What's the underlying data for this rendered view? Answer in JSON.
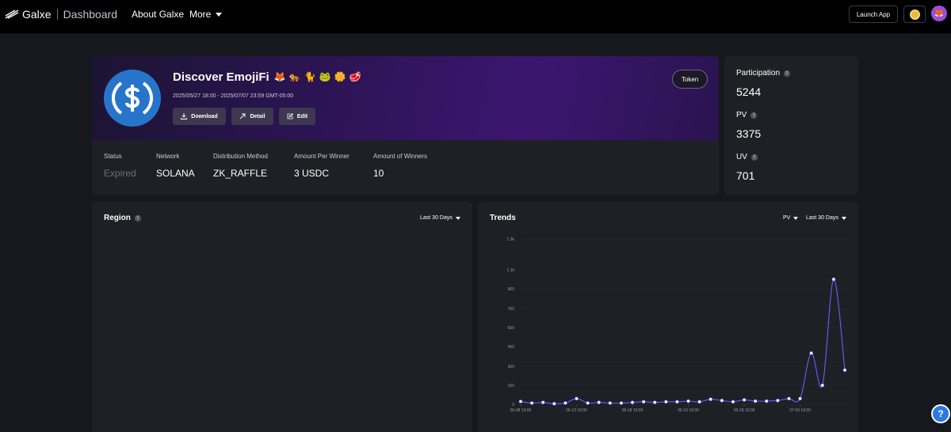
{
  "topbar": {
    "brand": "Galxe",
    "section": "Dashboard",
    "nav": {
      "about": "About Galxe",
      "more": "More"
    },
    "launch_label": "Launch App"
  },
  "campaign": {
    "title": "Discover EmojiFi",
    "emojis": [
      "🦊",
      "🐅",
      "🐈",
      "🐸",
      "🌼",
      "🥩"
    ],
    "dates": "2025/05/27 18:00 - 2025/07/07 23:59 GMT-05:00",
    "buttons": {
      "download": "Download",
      "detail": "Detail",
      "edit": "Edit"
    },
    "tag": "Token",
    "info": [
      {
        "label": "Status",
        "value": "Expired"
      },
      {
        "label": "Network",
        "value": "SOLANA"
      },
      {
        "label": "Distribution Method",
        "value": "ZK_RAFFLE"
      },
      {
        "label": "Amount Per Winner",
        "value": "3 USDC"
      },
      {
        "label": "Amount of Winners",
        "value": "10"
      }
    ]
  },
  "stats": {
    "participation": {
      "label": "Participation",
      "value": "5244"
    },
    "pv": {
      "label": "PV",
      "value": "3375"
    },
    "uv": {
      "label": "UV",
      "value": "701"
    }
  },
  "region": {
    "title": "Region",
    "range": "Last 30 Days"
  },
  "trends": {
    "title": "Trends",
    "metric": "PV",
    "range": "Last 30 Days"
  },
  "colors": {
    "accent": "#6b5cff",
    "token_blue": "#2775ca",
    "background": "#16181d",
    "card": "#1e2025"
  },
  "chart_data": {
    "type": "line",
    "ylim": [
      0,
      1200
    ],
    "y_ticks": [
      "0",
      "150",
      "300",
      "450",
      "600",
      "750",
      "900",
      "1.1k",
      "1.2k"
    ],
    "x_tick_labels": [
      "06-08 19:00",
      "06-13 19:00",
      "06-18 19:00",
      "06-23 19:00",
      "06-28 19:00",
      "07-03 19:00"
    ],
    "x": [
      "06-08 19:00",
      "06-09 19:00",
      "06-10 19:00",
      "06-11 19:00",
      "06-12 19:00",
      "06-13 19:00",
      "06-14 19:00",
      "06-15 19:00",
      "06-16 19:00",
      "06-17 19:00",
      "06-18 19:00",
      "06-19 19:00",
      "06-20 19:00",
      "06-21 19:00",
      "06-22 19:00",
      "06-23 19:00",
      "06-24 19:00",
      "06-25 19:00",
      "06-26 19:00",
      "06-27 19:00",
      "06-28 19:00",
      "06-29 19:00",
      "06-30 19:00",
      "07-01 19:00",
      "07-02 19:00",
      "07-03 19:00",
      "07-04 19:00",
      "07-05 19:00",
      "07-06 19:00",
      "07-07 19:00"
    ],
    "series": [
      {
        "values": [
          22,
          10,
          15,
          5,
          10,
          45,
          10,
          15,
          10,
          10,
          15,
          20,
          15,
          20,
          20,
          25,
          20,
          40,
          30,
          20,
          35,
          25,
          25,
          30,
          45,
          45,
          400,
          150,
          1000,
          270
        ]
      }
    ],
    "grid": true
  }
}
